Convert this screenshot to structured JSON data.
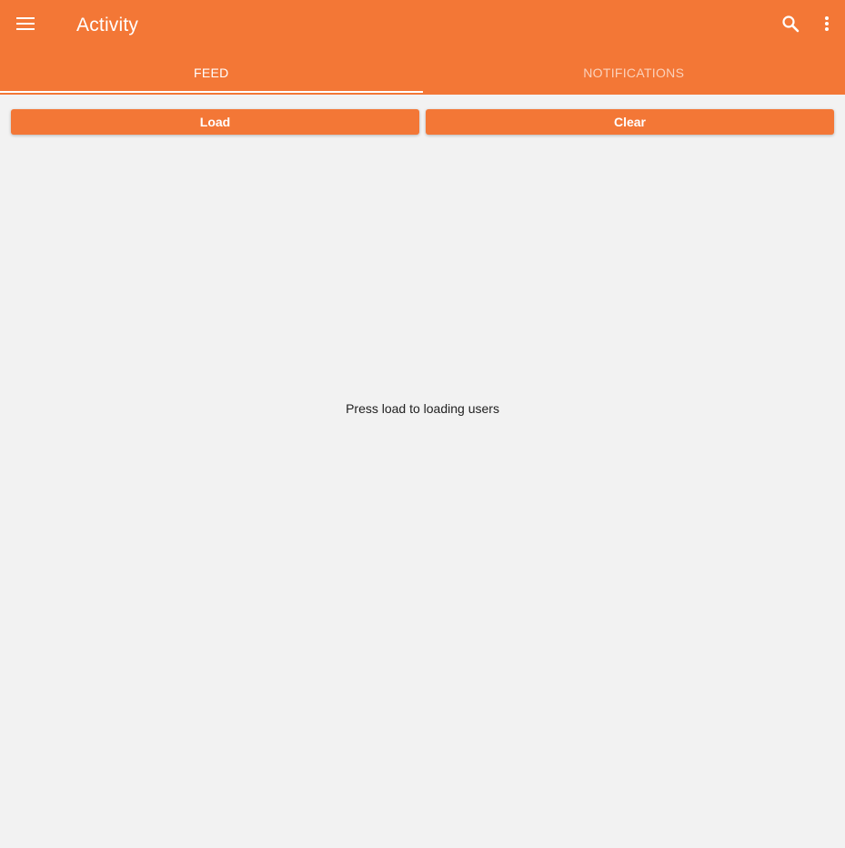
{
  "appbar": {
    "title": "Activity",
    "color": "#f37736",
    "icons": {
      "menu": "menu-icon",
      "search": "search-icon",
      "more": "more-vert-icon"
    }
  },
  "tabs": [
    {
      "label": "FEED",
      "active": true
    },
    {
      "label": "NOTIFICATIONS",
      "active": false
    }
  ],
  "actions": {
    "load_label": "Load",
    "clear_label": "Clear"
  },
  "main": {
    "empty_message": "Press load to loading users"
  }
}
